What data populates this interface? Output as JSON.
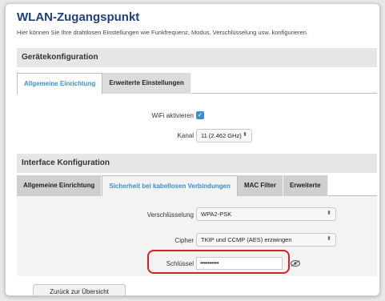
{
  "page": {
    "title": "WLAN-Zugangspunkt",
    "description": "Hier können Sie Ihre drahtlosen Einstellungen wie Funkfrequenz, Modus, Verschlüsselung usw. konfigurieren."
  },
  "device_config": {
    "header": "Gerätekonfiguration",
    "tabs": [
      {
        "label": "Allgemeine Einrichtung",
        "active": true
      },
      {
        "label": "Erweiterte Einstellungen",
        "active": false
      }
    ],
    "wifi_label": "WiFi aktivieren",
    "wifi_enabled": true,
    "channel_label": "Kanal",
    "channel_value": "11 (2.462 GHz)"
  },
  "interface_config": {
    "header": "Interface Konfiguration",
    "tabs": [
      {
        "label": "Allgemeine Einrichtung",
        "active": false
      },
      {
        "label": "Sicherheit bei kabellosen Verbindungen",
        "active": true
      },
      {
        "label": "MAC Filter",
        "active": false
      },
      {
        "label": "Erweiterte",
        "active": false
      }
    ],
    "encryption_label": "Verschlüsselung",
    "encryption_value": "WPA2-PSK",
    "cipher_label": "Cipher",
    "cipher_value": "TKIP und CCMP (AES) erzwingen",
    "key_label": "Schlüssel",
    "key_value": "••••••••••",
    "highlight_color": "#d8202a"
  },
  "footer": {
    "back_button": "Zurück zur Übersicht"
  },
  "colors": {
    "title": "#1f3f7a",
    "accent": "#3a8fd1"
  }
}
